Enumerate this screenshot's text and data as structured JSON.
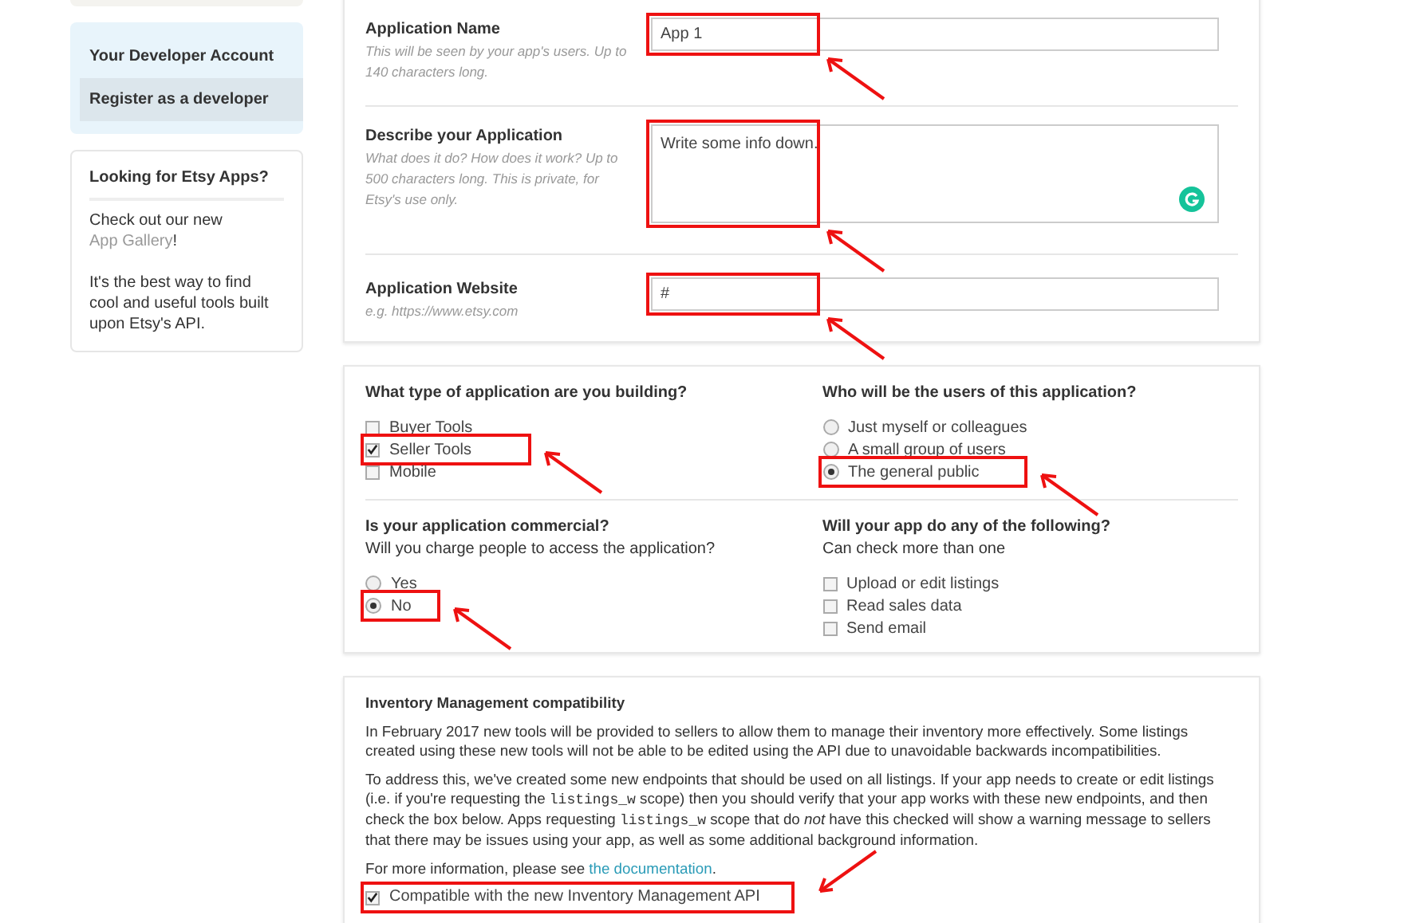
{
  "sidebar": {
    "nav": {
      "items": [
        {
          "label": "Your Developer Account",
          "selected": false
        },
        {
          "label": "Register as a developer",
          "selected": true
        }
      ]
    },
    "promo": {
      "title": "Looking for Etsy Apps?",
      "text": "Check out our new",
      "link": "App Gallery",
      "after": "!",
      "text2": "It's the best way to find cool and useful tools built upon Etsy's API."
    }
  },
  "details": [
    {
      "label": "Application Name",
      "hint": "This will be seen by your app's users. Up to 140 characters long.",
      "kind": "input",
      "value": "App 1",
      "highlighted": true
    },
    {
      "label": "Describe your Application",
      "hint": "What does it do? How does it work? Up to 500 characters long. This is private, for Etsy's use only.",
      "kind": "textarea",
      "value": "Write some info down.",
      "highlighted": true
    },
    {
      "label": "Application Website",
      "hint": "e.g. https://www.etsy.com",
      "kind": "input",
      "value": "#",
      "highlighted": true
    }
  ],
  "questions": [
    {
      "title": "What type of application are you building?",
      "kind": "checkbox",
      "options": [
        {
          "label": "Buyer Tools",
          "checked": false,
          "highlighted": false
        },
        {
          "label": "Seller Tools",
          "checked": true,
          "highlighted": true
        },
        {
          "label": "Mobile",
          "checked": false,
          "highlighted": false
        }
      ]
    },
    {
      "title": "Who will be the users of this application?",
      "kind": "radio",
      "options": [
        {
          "label": "Just myself or colleagues",
          "checked": false,
          "highlighted": false
        },
        {
          "label": "A small group of users",
          "checked": false,
          "highlighted": false
        },
        {
          "label": "The general public",
          "checked": true,
          "highlighted": true
        }
      ]
    },
    {
      "title": "Is your application commercial?",
      "subtitle": "Will you charge people to access the application?",
      "kind": "radio",
      "options": [
        {
          "label": "Yes",
          "checked": false,
          "highlighted": false
        },
        {
          "label": "No",
          "checked": true,
          "highlighted": true
        }
      ]
    },
    {
      "title": "Will your app do any of the following?",
      "subtitle": "Can check more than one",
      "kind": "checkbox",
      "options": [
        {
          "label": "Upload or edit listings",
          "checked": false,
          "highlighted": false
        },
        {
          "label": "Read sales data",
          "checked": false,
          "highlighted": false
        },
        {
          "label": "Send email",
          "checked": false,
          "highlighted": false
        }
      ]
    }
  ],
  "inventory": {
    "title": "Inventory Management compatibility",
    "paragraphs": [
      [
        {
          "kind": "text",
          "text": "In February 2017 new tools will be provided to sellers to allow them to manage their inventory more effectively. Some listings created using these new tools will not be able to be edited using the API due to unavoidable backwards incompatibilities."
        }
      ],
      [
        {
          "kind": "text",
          "text": "To address this, we've created some new endpoints that should be used on all listings. If your app needs to create or edit listings (i.e. if you're requesting the "
        },
        {
          "kind": "code",
          "text": "listings_w"
        },
        {
          "kind": "text",
          "text": " scope) then you should verify that your app works with these new endpoints, and then check the box below. Apps requesting "
        },
        {
          "kind": "code",
          "text": "listings_w"
        },
        {
          "kind": "text",
          "text": " scope that do "
        },
        {
          "kind": "em",
          "text": "not"
        },
        {
          "kind": "text",
          "text": " have this checked will show a warning message to sellers that there may be issues using your app, as well as some additional background information."
        }
      ]
    ],
    "more": "For more information, please see ",
    "link": "the documentation",
    "after": ".",
    "checkbox": {
      "label": "Compatible with the new Inventory Management API",
      "checked": true,
      "highlighted": true
    }
  }
}
